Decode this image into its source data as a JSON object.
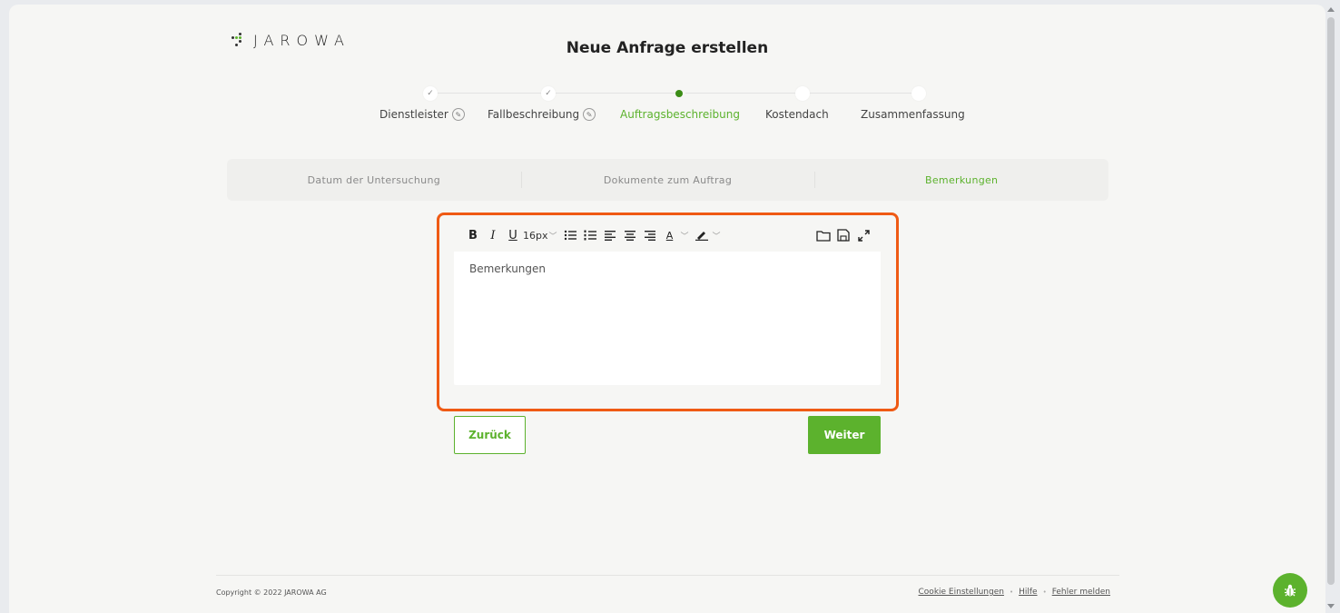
{
  "brand": {
    "name": "JAROWA"
  },
  "page": {
    "title": "Neue Anfrage erstellen"
  },
  "stepper": {
    "steps": [
      {
        "label": "Dienstleister",
        "state": "done"
      },
      {
        "label": "Fallbeschreibung",
        "state": "done"
      },
      {
        "label": "Auftragsbeschreibung",
        "state": "active"
      },
      {
        "label": "Kostendach",
        "state": "pending"
      },
      {
        "label": "Zusammenfassung",
        "state": "pending"
      }
    ]
  },
  "tabs": [
    {
      "label": "Datum der Untersuchung",
      "active": false
    },
    {
      "label": "Dokumente zum Auftrag",
      "active": false
    },
    {
      "label": "Bemerkungen",
      "active": true
    }
  ],
  "editor": {
    "font_size": "16px",
    "placeholder": "Bemerkungen",
    "toolbar_icons": [
      "bold-icon",
      "italic-icon",
      "underline-icon",
      "font-size-select",
      "bullet-list-icon",
      "numbered-list-icon",
      "align-left-icon",
      "align-center-icon",
      "align-right-icon",
      "text-color-icon",
      "highlight-color-icon",
      "open-folder-icon",
      "save-icon",
      "fullscreen-icon"
    ]
  },
  "actions": {
    "back_label": "Zurück",
    "next_label": "Weiter"
  },
  "footer": {
    "copyright": "Copyright © 2022 JAROWA AG",
    "links": [
      "Cookie Einstellungen",
      "Hilfe",
      "Fehler melden"
    ]
  },
  "colors": {
    "accent": "#5cb22d",
    "highlight": "#ef5a14"
  }
}
